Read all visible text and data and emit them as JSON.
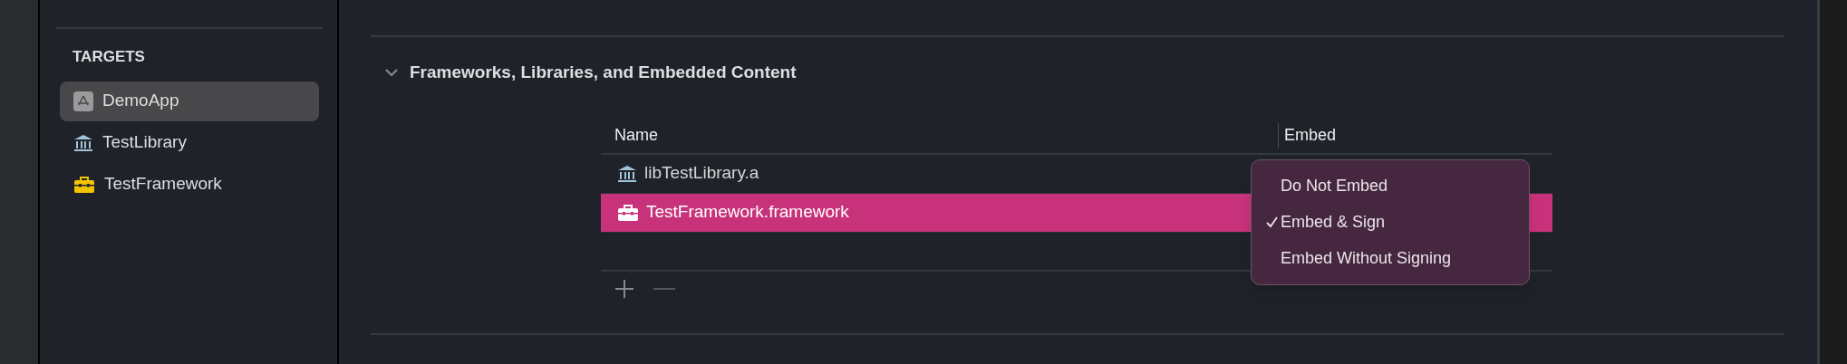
{
  "sidebar": {
    "section_title": "TARGETS",
    "items": [
      {
        "label": "DemoApp",
        "kind": "app",
        "selected": true
      },
      {
        "label": "TestLibrary",
        "kind": "library",
        "selected": false
      },
      {
        "label": "TestFramework",
        "kind": "framework",
        "selected": false
      }
    ]
  },
  "section": {
    "title": "Frameworks, Libraries, and Embedded Content",
    "expanded": true,
    "table": {
      "columns": [
        "Name",
        "Embed"
      ],
      "rows": [
        {
          "name": "libTestLibrary.a",
          "kind": "library",
          "selected": false
        },
        {
          "name": "TestFramework.framework",
          "kind": "framework",
          "selected": true
        }
      ]
    },
    "embed_menu": {
      "options": [
        {
          "label": "Do Not Embed",
          "selected": false
        },
        {
          "label": "Embed & Sign",
          "selected": true
        },
        {
          "label": "Embed Without Signing",
          "selected": false
        }
      ]
    }
  }
}
